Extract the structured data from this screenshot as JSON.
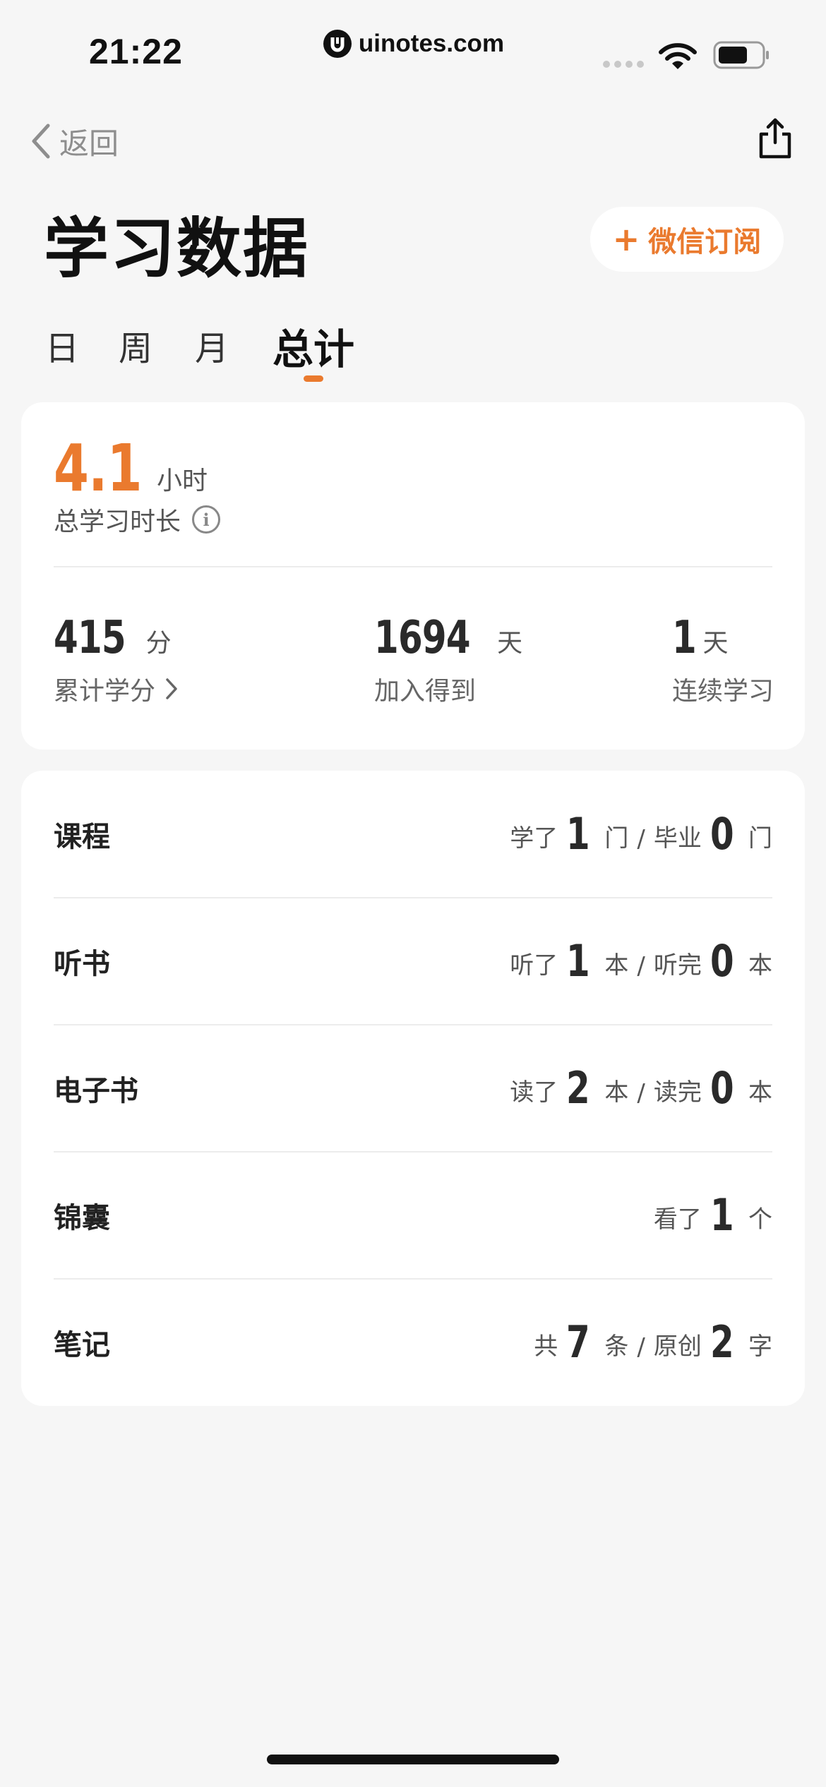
{
  "status_bar": {
    "time": "21:22",
    "url": "uinotes.com"
  },
  "nav": {
    "back_label": "返回"
  },
  "header": {
    "title": "学习数据",
    "subscribe_label": "微信订阅"
  },
  "tabs": [
    {
      "label": "日",
      "active": false
    },
    {
      "label": "周",
      "active": false
    },
    {
      "label": "月",
      "active": false
    },
    {
      "label": "总计",
      "active": true
    }
  ],
  "summary": {
    "total_hours": "4.1",
    "total_hours_unit": "小时",
    "total_label": "总学习时长",
    "stats": [
      {
        "value": "415",
        "unit": "分",
        "label": "累计学分"
      },
      {
        "value": "1694",
        "unit": "天",
        "label": "加入得到"
      },
      {
        "value": "1",
        "unit": "天",
        "label": "连续学习"
      }
    ]
  },
  "list": {
    "items": [
      {
        "title": "课程",
        "a_text": "学了",
        "a_num": "1",
        "a_unit": "门",
        "b_text": "毕业",
        "b_num": "0",
        "b_unit": "门"
      },
      {
        "title": "听书",
        "a_text": "听了",
        "a_num": "1",
        "a_unit": "本",
        "b_text": "听完",
        "b_num": "0",
        "b_unit": "本"
      },
      {
        "title": "电子书",
        "a_text": "读了",
        "a_num": "2",
        "a_unit": "本",
        "b_text": "读完",
        "b_num": "0",
        "b_unit": "本"
      },
      {
        "title": "锦囊",
        "a_text": "看了",
        "a_num": "1",
        "a_unit": "个"
      },
      {
        "title": "笔记",
        "a_text": "共",
        "a_num": "7",
        "a_unit": "条",
        "b_text": "原创",
        "b_num": "2",
        "b_unit": "字"
      }
    ],
    "separator": "/"
  },
  "colors": {
    "accent": "#ea7a2e",
    "background": "#f6f6f6",
    "card": "#ffffff"
  }
}
